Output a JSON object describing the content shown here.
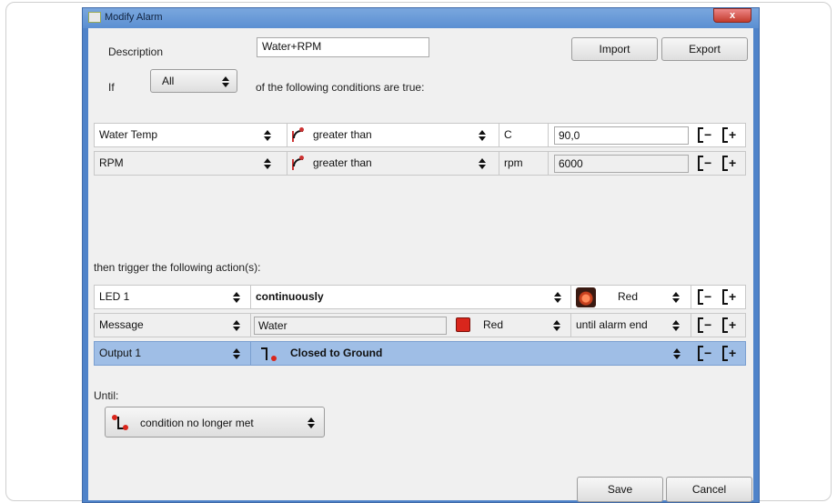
{
  "window": {
    "title": "Modify Alarm",
    "close_label": "x"
  },
  "header": {
    "description_label": "Description",
    "description_value": "Water+RPM",
    "import_label": "Import",
    "export_label": "Export",
    "if_label": "If",
    "if_select_value": "All",
    "conditions_text": "of the following conditions are true:"
  },
  "conditions": [
    {
      "channel": "Water Temp",
      "operator": "greater than",
      "unit": "C",
      "value": "90,0"
    },
    {
      "channel": "RPM",
      "operator": "greater than",
      "unit": "rpm",
      "value": "6000"
    }
  ],
  "actions_heading": "then trigger the following action(s):",
  "actions": {
    "led": {
      "target": "LED 1",
      "mode": "continuously",
      "color": "Red"
    },
    "message": {
      "target": "Message",
      "text": "Water",
      "color": "Red",
      "duration": "until alarm end"
    },
    "output": {
      "target": "Output 1",
      "state": "Closed to Ground"
    }
  },
  "until": {
    "label": "Until:",
    "value": "condition no longer met"
  },
  "footer": {
    "save_label": "Save",
    "cancel_label": "Cancel"
  },
  "row_buttons": {
    "minus_sign": "−",
    "plus_sign": "+"
  },
  "colors": {
    "titlebar": "#5b8fd2",
    "selected_row": "#9fbee6",
    "swatch_red": "#d9261c"
  }
}
